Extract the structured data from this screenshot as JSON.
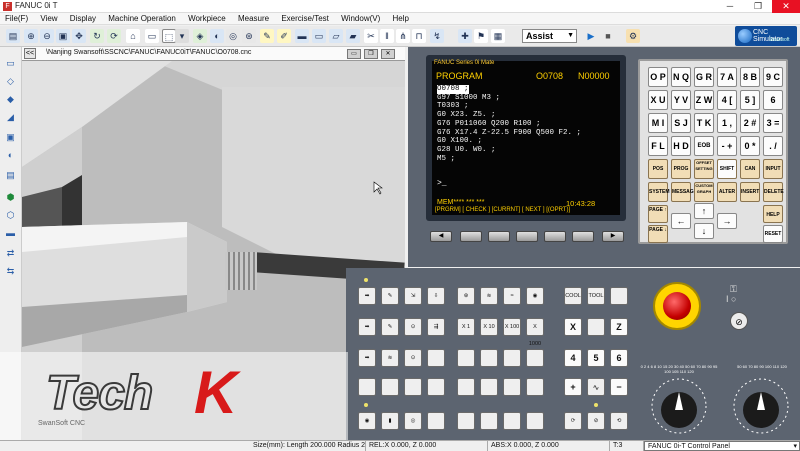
{
  "window": {
    "title": "FANUC 0i T",
    "icon_letter": "F",
    "buttons": [
      "─",
      "❐",
      "✕"
    ]
  },
  "menu": [
    "File(F)",
    "View",
    "Display",
    "Machine Operation",
    "Workpiece",
    "Measure",
    "Exercise/Test",
    "Window(V)",
    "Help"
  ],
  "toolbar": {
    "icons": [
      "save-icon",
      "zoom-icon",
      "zoom-fit-icon",
      "zoom-window-icon",
      "pan-icon",
      "rotate-icon",
      "reset-view-icon",
      "refresh-icon",
      "window-icon",
      "fit-icon",
      "cut-icon",
      "mirror-icon",
      "tool-icon",
      "chuck-icon",
      "measure-icon",
      "sketch-icon",
      "tailstock-icon",
      "pipe-icon",
      "cylinder-icon",
      "box-icon",
      "drill-icon",
      "slot-icon",
      "clamp-icon",
      "lock-icon",
      "arrow-icon",
      "plus-icon",
      "flag-icon",
      "lock2-icon"
    ],
    "assist_value": "Assist",
    "play_icon": "▶",
    "stop_icon": "■",
    "logo_line1": "CNC Simulator",
    "logo_line2": "Swansoft"
  },
  "view3d": {
    "path": "\\Nanjing Swansoft\\SSCNC\\FANUC\\FANUC0iT\\FANUC\\O0708.cnc",
    "collapse_label": "<<"
  },
  "crt": {
    "brand": "FANUC Series 0i Mate",
    "mode_title": "PROGRAM",
    "program_no": "O0708",
    "seq_no": "N00000",
    "code_lines": [
      "O0708 ;",
      "G97 S1000 M3 ;",
      "T0303 ;",
      "G0 X23. Z5. ;",
      "G76 P011060 Q200 R100 ;",
      "G76 X17.4 Z-22.5 F900 Q500 F2. ;",
      "G0 X100. ;",
      "G28 U0. W0. ;",
      "M5 ;"
    ],
    "cursor": ">_",
    "mode_line": "MEM**** ***    ***",
    "time": "10:43:28",
    "softkeys": "[PRGRM] [ CHECK ] [CURRNT] [ NEXT ] [(OPRT)]"
  },
  "keypad": {
    "keys": [
      "O P",
      "N Q",
      "G R",
      "7 A",
      "8 B",
      "9 C",
      "X U",
      "Y V",
      "Z W",
      "4 [",
      "5 ]",
      "6 SP",
      "M I",
      "S J",
      "T K",
      "1 ,",
      "2 #",
      "3 =",
      "F L",
      "H D",
      "EOB E",
      "- +",
      "0 *",
      ". /"
    ],
    "function_keys": [
      "POS",
      "PROG",
      "OFFSET SETTING",
      "SHIFT",
      "CAN",
      "INPUT",
      "SYSTEM",
      "MESSAGE",
      "CUSTOM GRAPH",
      "ALTER",
      "INSERT",
      "DELETE"
    ],
    "page_up": "PAGE ↑",
    "page_down": "PAGE ↓",
    "help": "HELP",
    "reset": "RESET"
  },
  "operator_panel": {
    "step_labels": [
      "X 1",
      "X 10",
      "X 100",
      "X 1000"
    ],
    "cool_label": "COOL",
    "tool_label": "TOOL",
    "axis_x": "X",
    "axis_z": "Z",
    "num_4": "4",
    "num_5": "5",
    "num_6": "6",
    "plus": "+",
    "minus": "−",
    "feed_scale": "0 2 4 6 8 10 15 20 30 40 50 60 70 80 90 95 100 105 110 120",
    "spindle_scale": "50 60 70 80 90 100 110 120"
  },
  "statusbar": {
    "size": "Size(mm): Length 200.000 Radius 25",
    "rel": "REL:X   0.000, Z   0.000",
    "abs": "ABS:X   0.000, Z   0.000",
    "tool": "T:3",
    "panel": "FANUC 0i-T Control Panel"
  },
  "watermark": {
    "part1": "Tech",
    "part2": "K",
    "sub": "SwanSoft CNC"
  }
}
